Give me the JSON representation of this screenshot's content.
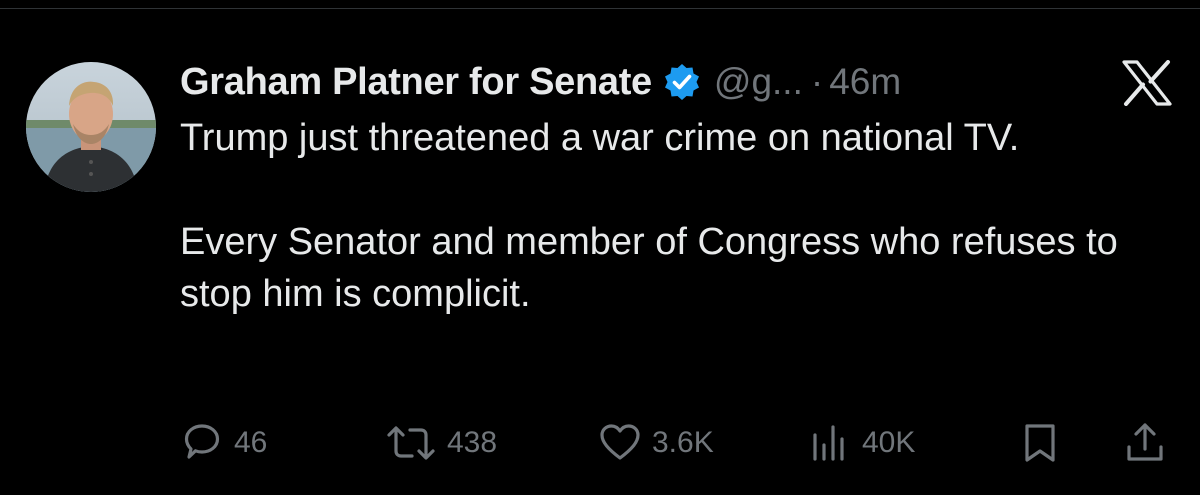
{
  "tweet": {
    "display_name": "Graham Platner for Senate",
    "handle": "@g...",
    "separator": "·",
    "time": "46m",
    "verified": true,
    "paragraphs": [
      "Trump just threatened a war crime on national TV.",
      "Every Senator and member of Congress who refuses to stop him is complicit."
    ]
  },
  "actions": {
    "replies": "46",
    "reposts": "438",
    "likes": "3.6K",
    "views": "40K"
  },
  "icons": {
    "verified": "verified-badge-icon",
    "platform_logo": "x-logo-icon",
    "reply": "reply-icon",
    "repost": "repost-icon",
    "like": "heart-icon",
    "views": "views-icon",
    "bookmark": "bookmark-icon",
    "share": "share-icon"
  },
  "colors": {
    "background": "#000000",
    "text": "#e7e9ea",
    "secondary": "#71767b",
    "verified": "#1d9bf0"
  }
}
